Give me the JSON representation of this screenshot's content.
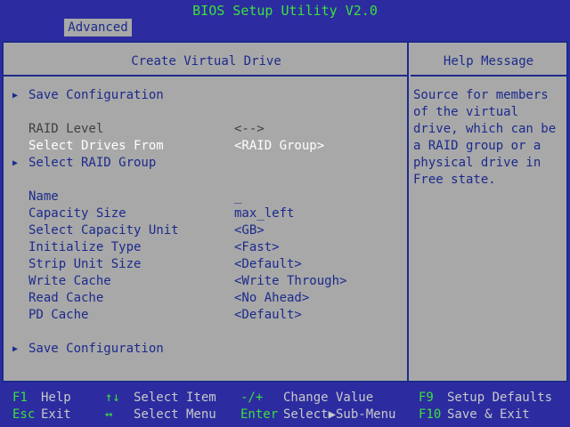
{
  "app_title": "BIOS Setup Utility V2.0",
  "tab": "Advanced",
  "panel_title": "Create Virtual Drive",
  "help_title": "Help Message",
  "help_text": "Source for members\nof the virtual\ndrive, which can be\na RAID group or a\nphysical drive in\nFree state.",
  "items": [
    {
      "label": "Save Configuration",
      "value": ""
    },
    {
      "label": "RAID Level",
      "value": "<-->"
    },
    {
      "label": "Select Drives From",
      "value": "<RAID Group>"
    },
    {
      "label": "Select RAID Group",
      "value": ""
    },
    {
      "label": "Name",
      "value": "_"
    },
    {
      "label": "Capacity Size",
      "value": "max_left"
    },
    {
      "label": "Select Capacity Unit",
      "value": "<GB>"
    },
    {
      "label": "Initialize Type",
      "value": "<Fast>"
    },
    {
      "label": "Strip Unit Size",
      "value": "<Default>"
    },
    {
      "label": "Write Cache",
      "value": "<Write Through>"
    },
    {
      "label": "Read Cache",
      "value": "<No Ahead>"
    },
    {
      "label": "PD Cache",
      "value": "<Default>"
    },
    {
      "label": "Save Configuration",
      "value": ""
    }
  ],
  "footer": [
    {
      "key": "F1",
      "desc": "Help"
    },
    {
      "key": "Esc",
      "desc": "Exit"
    },
    {
      "key": "↑↓",
      "desc": "Select Item"
    },
    {
      "key": "↔",
      "desc": "Select Menu"
    },
    {
      "key": "-/+",
      "desc": "Change Value"
    },
    {
      "key": "Enter",
      "desc": "Select▶Sub-Menu"
    },
    {
      "key": "F9",
      "desc": "Setup Defaults"
    },
    {
      "key": "F10",
      "desc": "Save & Exit"
    }
  ],
  "colors": {
    "background": "#2c2ca0",
    "panel": "#a8a8a8",
    "text": "#1c2a8c",
    "highlight": "#ffffff",
    "disabled": "#404040",
    "title": "#3ce03c",
    "footer_text": "#c8c8c8"
  },
  "icons": {
    "submenu": "triangle-right-icon"
  }
}
